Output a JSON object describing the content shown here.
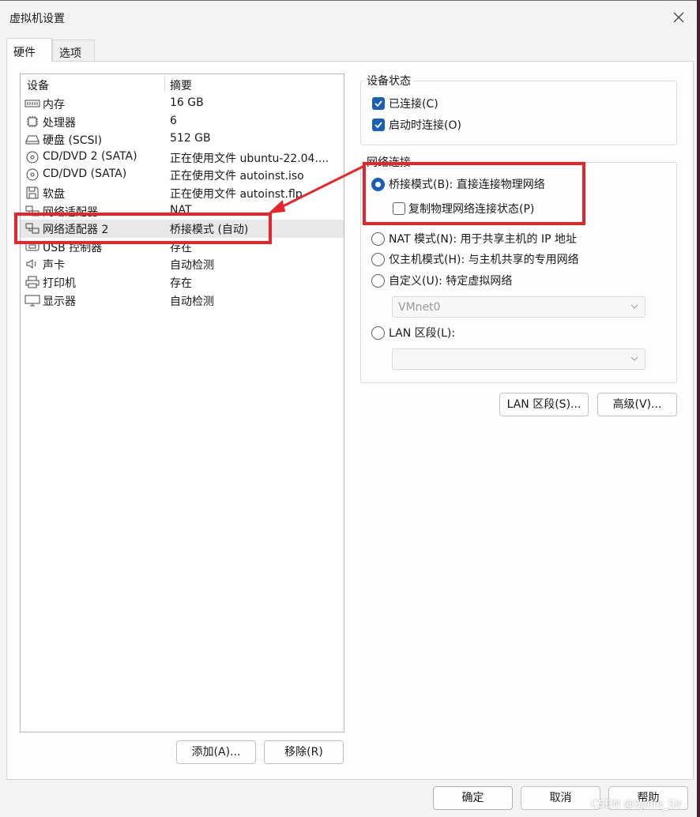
{
  "window": {
    "title": "虚拟机设置"
  },
  "tabs": [
    {
      "label": "硬件"
    },
    {
      "label": "选项"
    }
  ],
  "device_list": {
    "columns": [
      "设备",
      "摘要"
    ],
    "rows": [
      {
        "name": "内存",
        "summary": "16 GB",
        "icon": "memory-icon"
      },
      {
        "name": "处理器",
        "summary": "6",
        "icon": "cpu-icon"
      },
      {
        "name": "硬盘 (SCSI)",
        "summary": "512 GB",
        "icon": "hard-disk-icon"
      },
      {
        "name": "CD/DVD 2 (SATA)",
        "summary": "正在使用文件 ubuntu-22.04....",
        "icon": "cd-dvd-icon"
      },
      {
        "name": "CD/DVD (SATA)",
        "summary": "正在使用文件 autoinst.iso",
        "icon": "cd-dvd-icon"
      },
      {
        "name": "软盘",
        "summary": "正在使用文件 autoinst.flp",
        "icon": "floppy-icon"
      },
      {
        "name": "网络适配器",
        "summary": "NAT",
        "icon": "network-adapter-icon"
      },
      {
        "name": "网络适配器 2",
        "summary": "桥接模式 (自动)",
        "icon": "network-adapter-icon",
        "selected": true
      },
      {
        "name": "USB 控制器",
        "summary": "存在",
        "icon": "usb-icon"
      },
      {
        "name": "声卡",
        "summary": "自动检测",
        "icon": "speaker-icon"
      },
      {
        "name": "打印机",
        "summary": "存在",
        "icon": "printer-icon"
      },
      {
        "name": "显示器",
        "summary": "自动检测",
        "icon": "monitor-icon"
      }
    ]
  },
  "list_buttons": {
    "add": "添加(A)...",
    "remove": "移除(R)"
  },
  "device_status": {
    "title": "设备状态",
    "connected": {
      "label": "已连接(C)",
      "checked": true
    },
    "connect_at_power_on": {
      "label": "启动时连接(O)",
      "checked": true
    }
  },
  "network_connection": {
    "title": "网络连接",
    "bridged": {
      "label": "桥接模式(B): 直接连接物理网络",
      "selected": true
    },
    "replicate_state": {
      "label": "复制物理网络连接状态(P)",
      "checked": false
    },
    "nat": {
      "label": "NAT 模式(N): 用于共享主机的 IP 地址",
      "selected": false
    },
    "host_only": {
      "label": "仅主机模式(H): 与主机共享的专用网络",
      "selected": false
    },
    "custom": {
      "label": "自定义(U): 特定虚拟网络",
      "selected": false
    },
    "custom_select_value": "VMnet0",
    "lan_segment": {
      "label": "LAN 区段(L):",
      "selected": false
    },
    "lan_select_value": ""
  },
  "right_buttons": {
    "lan_segments": "LAN 区段(S)...",
    "advanced": "高级(V)..."
  },
  "footer": {
    "ok": "确定",
    "cancel": "取消",
    "help": "帮助"
  },
  "watermark": "CSDN @Spiffo_Sir",
  "colors": {
    "accent": "#1a5fb4",
    "annotation": "#e3262b",
    "desktop": "#4a1f33"
  }
}
